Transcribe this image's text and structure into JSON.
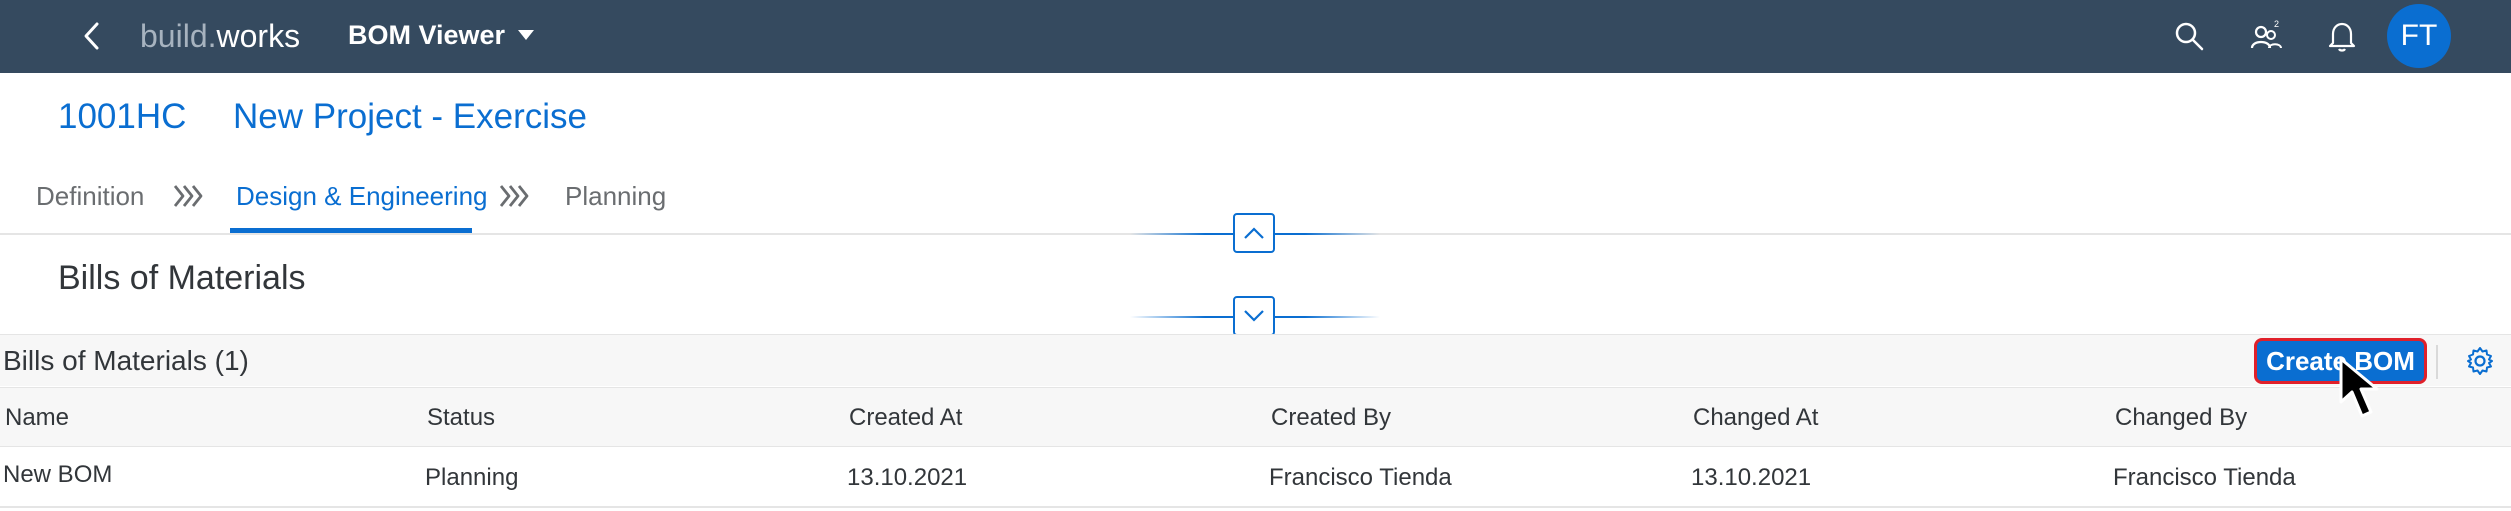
{
  "shell": {
    "logo_part1": "build.",
    "logo_part2": "works",
    "app_title": "BOM Viewer",
    "avatar_initials": "FT",
    "background_color": "#354a5f"
  },
  "object_header": {
    "id": "1001HC",
    "title": "New Project - Exercise"
  },
  "process_steps": [
    {
      "label": "Definition",
      "selected": false
    },
    {
      "label": "Design & Engineering",
      "selected": true
    },
    {
      "label": "Planning",
      "selected": false
    }
  ],
  "section": {
    "title": "Bills of Materials"
  },
  "table": {
    "title": "Bills of Materials (1)",
    "create_button_label": "Create BOM",
    "columns": [
      "Name",
      "Status",
      "Created At",
      "Created By",
      "Changed At",
      "Changed By"
    ],
    "rows": [
      {
        "name": "New BOM",
        "status": "Planning",
        "created_at": "13.10.2021",
        "created_by": "Francisco Tienda",
        "changed_at": "13.10.2021",
        "changed_by": "Francisco Tienda"
      }
    ]
  },
  "icons": {
    "back": "back-arrow-icon",
    "dropdown": "caret-down-icon",
    "search": "search-icon",
    "people": "people-icon",
    "notifications": "bell-icon",
    "collapse": "chevron-up-icon",
    "expand": "chevron-down-icon",
    "settings": "gear-icon"
  },
  "colors": {
    "accent": "#0a6ed1",
    "highlight_border": "#e0202a"
  }
}
